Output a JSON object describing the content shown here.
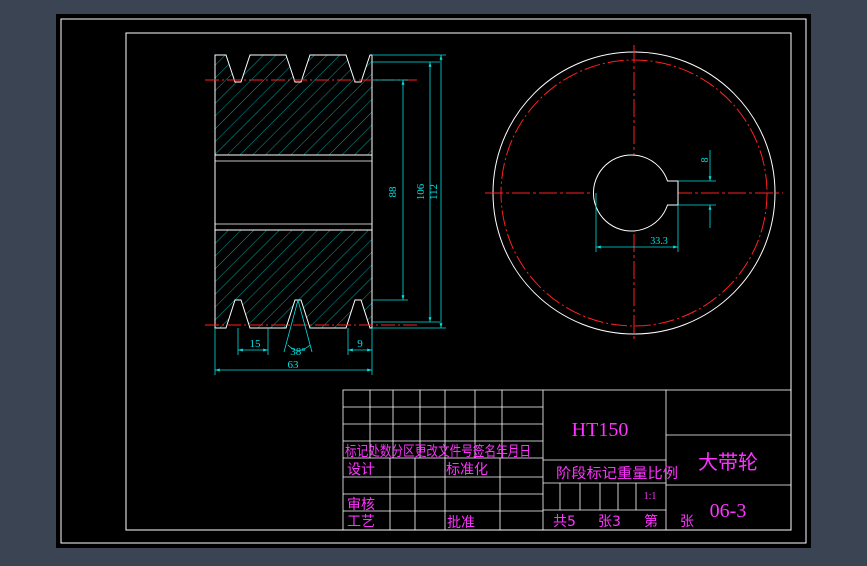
{
  "drawing": {
    "material": "HT150",
    "part_name": "大带轮",
    "drawing_number": "06-3",
    "scale": "1:1",
    "title_block": {
      "revision_header": "标记处数分区更改文件号签名年月日",
      "design": "设计",
      "standardization": "标准化",
      "stage_mark_weight_scale": "阶段标记重量比例",
      "review": "审核",
      "process": "工艺",
      "approve": "批准",
      "total": "共5",
      "sheets_a": "张3",
      "number": "第",
      "sheets_b": "张"
    },
    "dimensions": {
      "groove_pitch": "15",
      "groove_angle": "38°",
      "edge": "9",
      "width": "63",
      "bore_len": "88",
      "dia_106": "106",
      "dia_112": "112",
      "key_width": "8",
      "key_depth": "33.3"
    },
    "colors": {
      "background": "#000000",
      "frame": "#ffffff",
      "outline": "#ffffff",
      "hatch": "#00cccc",
      "centerline": "#ff2020",
      "dimension": "#00e0e0",
      "text_title": "#ff33ff"
    }
  }
}
